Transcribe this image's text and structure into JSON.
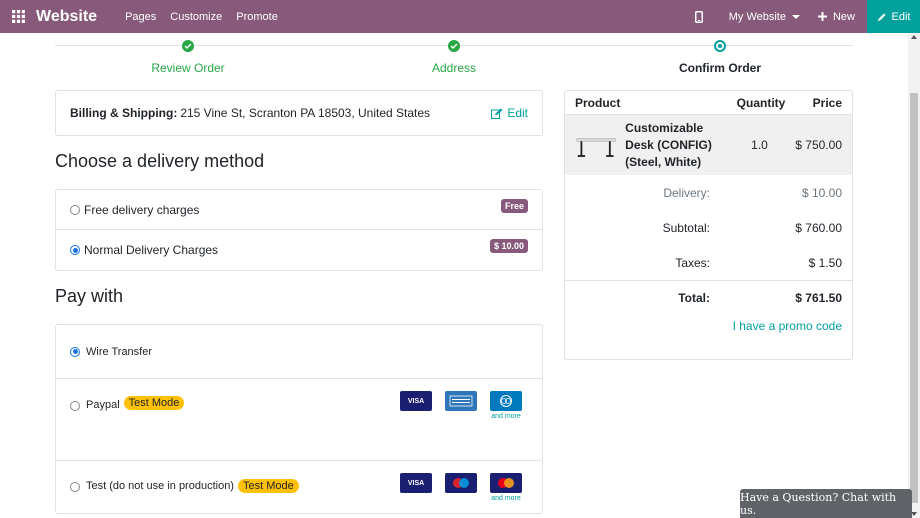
{
  "navbar": {
    "brand": "Website",
    "menu": [
      "Pages",
      "Customize",
      "Promote"
    ],
    "my_website": "My Website",
    "new_label": "New",
    "edit_label": "Edit",
    "bg_color": "#875a7b",
    "edit_color": "#00a09d"
  },
  "steps": [
    {
      "label": "Review Order",
      "state": "done"
    },
    {
      "label": "Address",
      "state": "done"
    },
    {
      "label": "Confirm Order",
      "state": "current"
    }
  ],
  "billing": {
    "label": "Billing & Shipping:",
    "address": "215 Vine St, Scranton PA 18503, United States",
    "edit_label": "Edit"
  },
  "delivery": {
    "title": "Choose a delivery method",
    "options": [
      {
        "label": "Free delivery charges",
        "price": "Free",
        "checked": false
      },
      {
        "label": "Normal Delivery Charges",
        "price": "$ 10.00",
        "checked": true
      }
    ]
  },
  "payment": {
    "title": "Pay with",
    "options": [
      {
        "label": "Wire Transfer",
        "checked": true,
        "badge": ""
      },
      {
        "label": "Paypal",
        "checked": false,
        "badge": "Test Mode",
        "cards": [
          "VISA",
          "AMEX",
          "Diners Club"
        ],
        "more": "and more"
      },
      {
        "label": "Test (do not use in production)",
        "checked": false,
        "badge": "Test Mode",
        "cards": [
          "VISA",
          "Maestro",
          "MasterCard"
        ],
        "more": "and more"
      }
    ]
  },
  "cart": {
    "headers": {
      "product": "Product",
      "quantity": "Quantity",
      "price": "Price"
    },
    "item": {
      "name": "Customizable Desk (CONFIG) (Steel, White)",
      "qty": "1.0",
      "price": "$ 750.00"
    },
    "delivery": {
      "label": "Delivery:",
      "value": "$ 10.00"
    },
    "subtotal": {
      "label": "Subtotal:",
      "value": "$ 760.00"
    },
    "taxes": {
      "label": "Taxes:",
      "value": "$ 1.50"
    },
    "total": {
      "label": "Total:",
      "value": "$ 761.50"
    },
    "promo": "I have a promo code"
  },
  "chat": "Have a Question? Chat with us."
}
